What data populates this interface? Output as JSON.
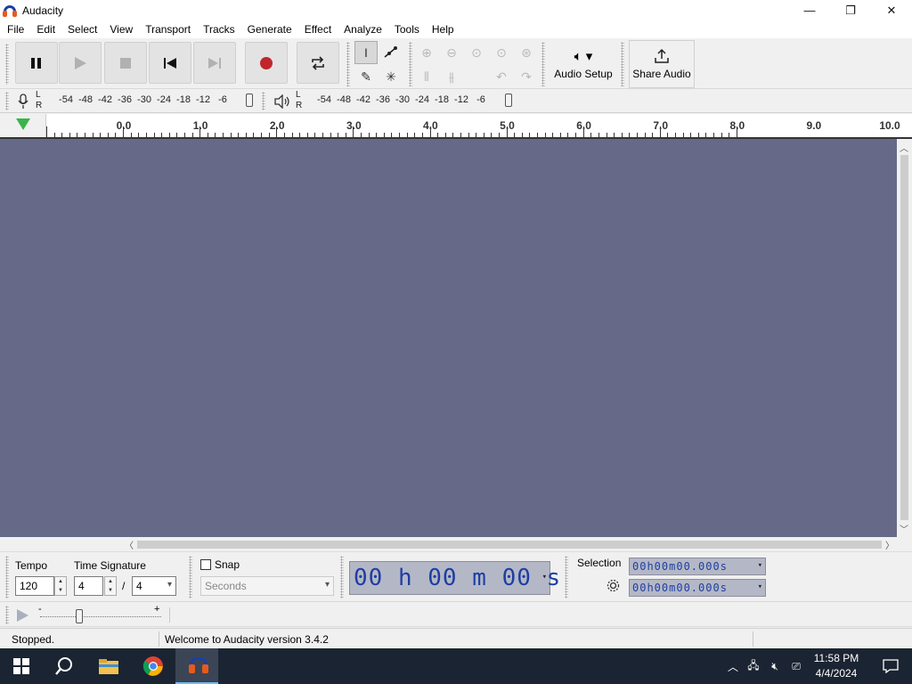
{
  "window": {
    "title": "Audacity",
    "minimize_glyph": "—",
    "restore_glyph": "❐",
    "close_glyph": "✕"
  },
  "menu": [
    "File",
    "Edit",
    "Select",
    "View",
    "Transport",
    "Tracks",
    "Generate",
    "Effect",
    "Analyze",
    "Tools",
    "Help"
  ],
  "transport": {
    "buttons": [
      {
        "name": "pause-button",
        "icon": "pause-icon",
        "enabled": true
      },
      {
        "name": "play-button",
        "icon": "play-icon",
        "enabled": false
      },
      {
        "name": "stop-button",
        "icon": "stop-icon",
        "enabled": false
      },
      {
        "name": "skip-to-start-button",
        "icon": "skip-start-icon",
        "enabled": true
      },
      {
        "name": "skip-to-end-button",
        "icon": "skip-end-icon",
        "enabled": false
      },
      {
        "name": "record-button",
        "icon": "record-icon",
        "enabled": true
      },
      {
        "name": "loop-button",
        "icon": "loop-icon",
        "enabled": true
      }
    ],
    "record_color": "#c0262c"
  },
  "audio_setup": {
    "label": "Audio Setup",
    "icon": "speaker-icon"
  },
  "share_audio": {
    "label": "Share Audio",
    "icon": "upload-icon"
  },
  "meters": {
    "record": {
      "l": "L",
      "r": "R",
      "ticks": [
        "-54",
        "-48",
        "-42",
        "-36",
        "-30",
        "-24",
        "-18",
        "-12",
        "-6"
      ]
    },
    "playback": {
      "l": "L",
      "r": "R",
      "ticks": [
        "-54",
        "-48",
        "-42",
        "-36",
        "-30",
        "-24",
        "-18",
        "-12",
        "-6"
      ]
    }
  },
  "ruler": {
    "labels": [
      "0.0",
      "1.0",
      "2.0",
      "3.0",
      "4.0",
      "5.0",
      "6.0",
      "7.0",
      "8.0",
      "9.0",
      "10.0"
    ]
  },
  "colors": {
    "track_bg": "#666a88",
    "timer_text": "#1f3ea3",
    "timer_bg": "#b4b8c6",
    "playhead": "#3ab44a"
  },
  "tempo": {
    "label": "Tempo",
    "value": "120"
  },
  "time_signature": {
    "label": "Time Signature",
    "numerator": "4",
    "separator": "/",
    "denominator": "4"
  },
  "snap": {
    "label": "Snap",
    "checked": false,
    "unit": "Seconds"
  },
  "timer": {
    "hours": "00",
    "h": "h",
    "minutes": "00",
    "m": "m",
    "seconds": "00",
    "s": "s"
  },
  "selection": {
    "label": "Selection",
    "start": "00h00m00.000s",
    "end": "00h00m00.000s"
  },
  "play_speed": {
    "minus": "-",
    "plus": "+"
  },
  "status": {
    "state": "Stopped.",
    "message": "Welcome to Audacity version 3.4.2"
  },
  "taskbar": {
    "time": "11:58 PM",
    "date": "4/4/2024"
  }
}
